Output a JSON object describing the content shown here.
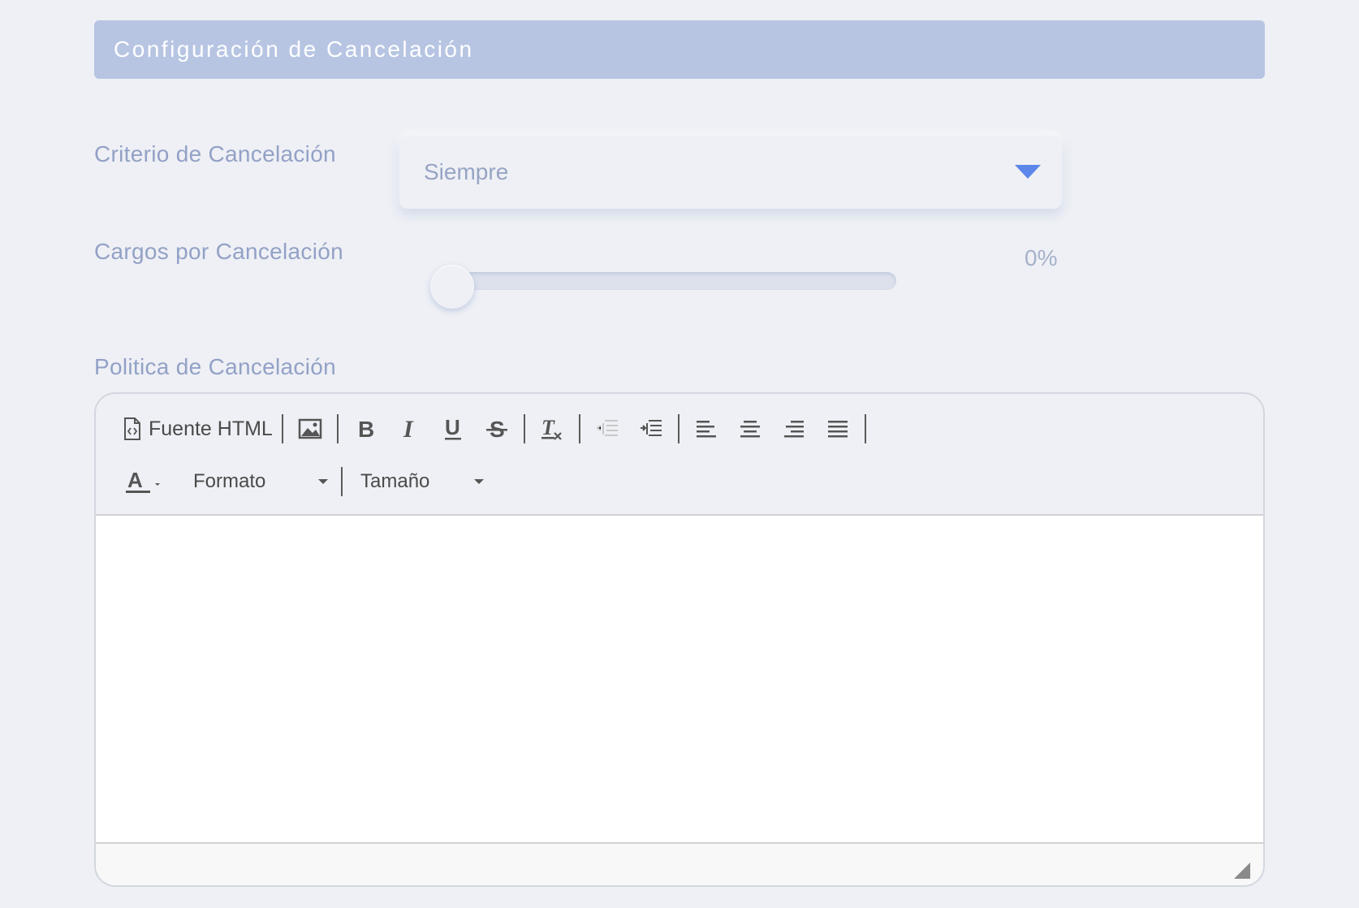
{
  "section": {
    "title": "Configuración de Cancelación"
  },
  "criterio": {
    "label": "Criterio de Cancelación",
    "selected": "Siempre"
  },
  "cargos": {
    "label": "Cargos por Cancelación",
    "value_text": "0%",
    "value_percent": 0
  },
  "politica": {
    "label": "Politica de Cancelación"
  },
  "toolbar": {
    "source_label": "Fuente HTML",
    "format_label": "Formato",
    "size_label": "Tamaño",
    "icons": [
      "source-icon",
      "image-icon",
      "bold-icon",
      "italic-icon",
      "underline-icon",
      "strikethrough-icon",
      "clear-format-icon",
      "outdent-icon",
      "indent-icon",
      "align-left-icon",
      "align-center-icon",
      "align-right-icon",
      "align-justify-icon",
      "text-color-icon"
    ]
  },
  "colors": {
    "background": "#eef0f5",
    "header": "#b7c5e3",
    "label": "#93a1c6",
    "accent": "#5d86ea"
  }
}
